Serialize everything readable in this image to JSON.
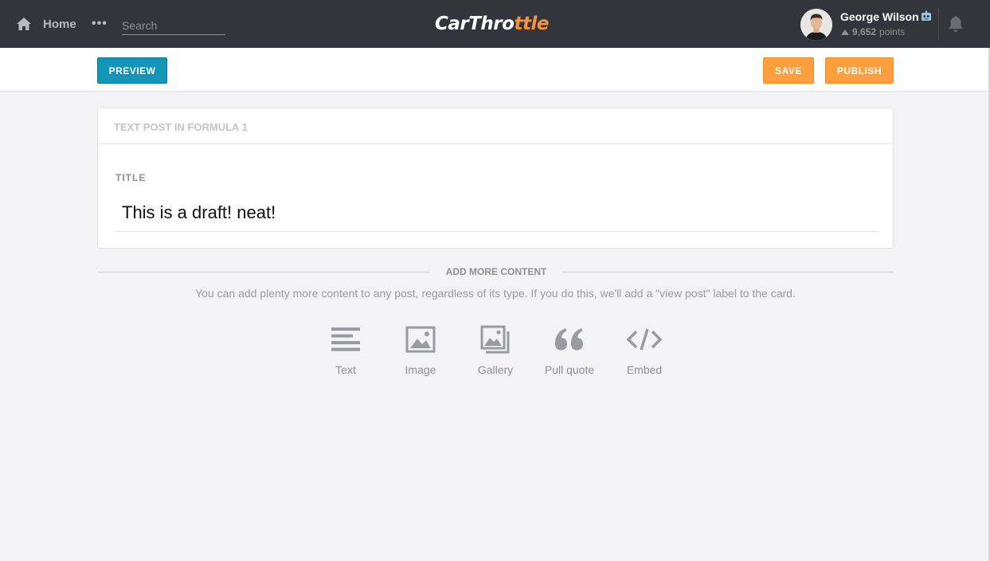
{
  "nav": {
    "home_label": "Home",
    "more_label": "•••",
    "search_placeholder": "Search",
    "logo_part1": "CarThro",
    "logo_part2": "ttle",
    "user_name": "George Wilson",
    "points_value": "9,652",
    "points_unit": "points"
  },
  "toolbar": {
    "preview_label": "PREVIEW",
    "save_label": "SAVE",
    "publish_label": "PUBLISH"
  },
  "post": {
    "header": "TEXT POST IN FORMULA 1",
    "title_label": "TITLE",
    "title_value": "This is a draft! neat!"
  },
  "add_more": {
    "title": "ADD MORE CONTENT",
    "description": "You can add plenty more content to any post, regardless of its type. If you do this, we'll add a \"view post\" label to the card.",
    "types": [
      {
        "label": "Text",
        "icon": "text-lines-icon"
      },
      {
        "label": "Image",
        "icon": "image-icon"
      },
      {
        "label": "Gallery",
        "icon": "gallery-icon"
      },
      {
        "label": "Pull quote",
        "icon": "quote-icon"
      },
      {
        "label": "Embed",
        "icon": "code-icon"
      }
    ]
  },
  "colors": {
    "nav_bg": "#34353c",
    "accent_orange": "#fe9f3e",
    "accent_blue": "#1395b8",
    "page_bg": "#f3f3f5"
  }
}
